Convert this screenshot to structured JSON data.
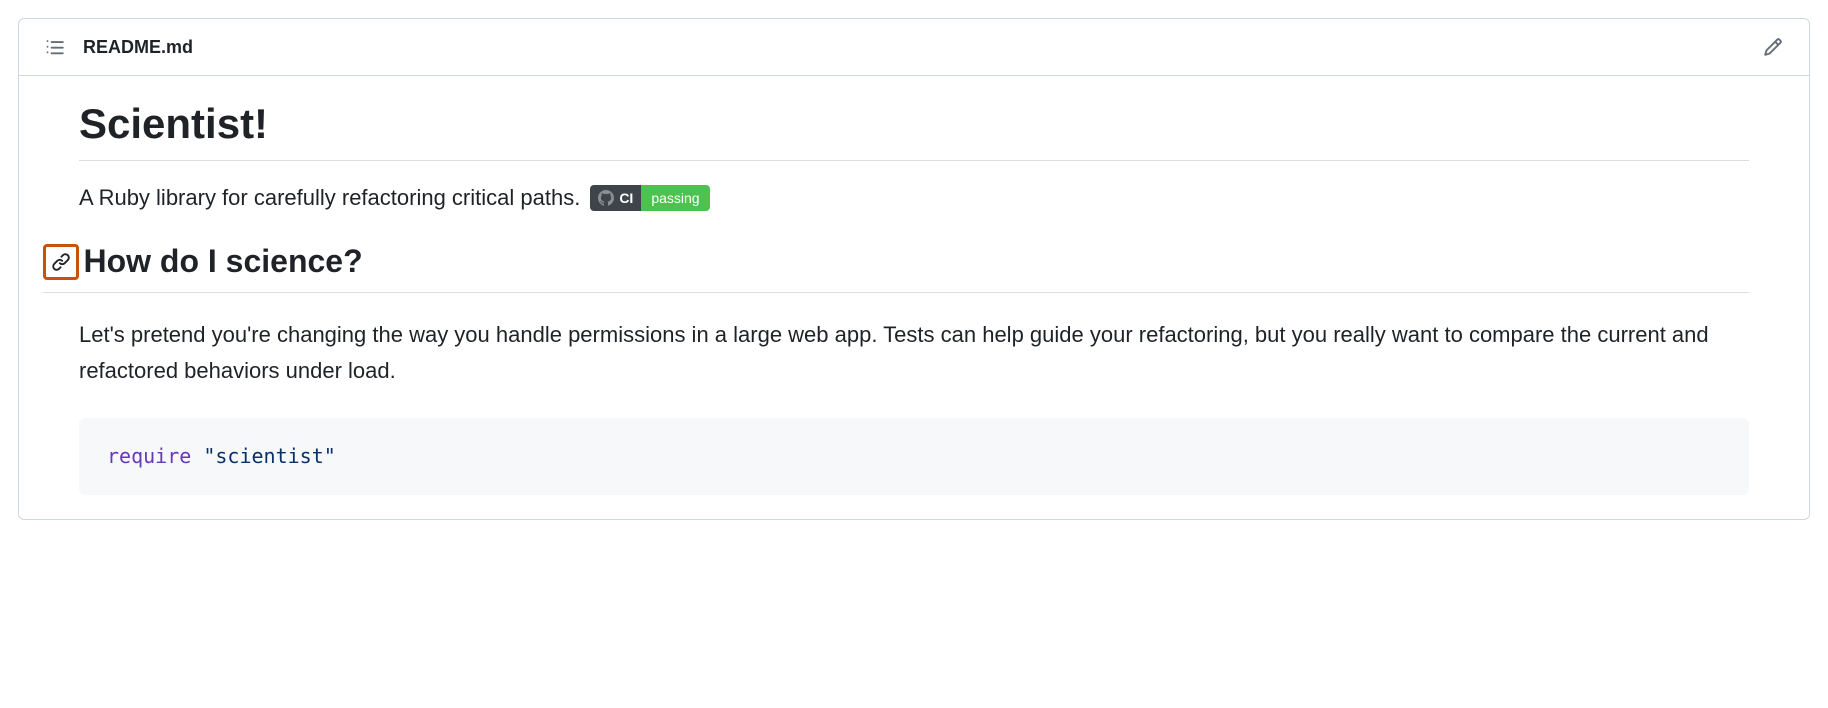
{
  "header": {
    "filename": "README.md"
  },
  "content": {
    "title": "Scientist!",
    "description": "A Ruby library for carefully refactoring critical paths.",
    "badge": {
      "left": "CI",
      "right": "passing"
    },
    "h2": "How do I science?",
    "paragraph": "Let's pretend you're changing the way you handle permissions in a large web app. Tests can help guide your refactoring, but you really want to compare the current and refactored behaviors under load.",
    "code": {
      "keyword": "require",
      "space": " ",
      "string": "\"scientist\""
    }
  }
}
